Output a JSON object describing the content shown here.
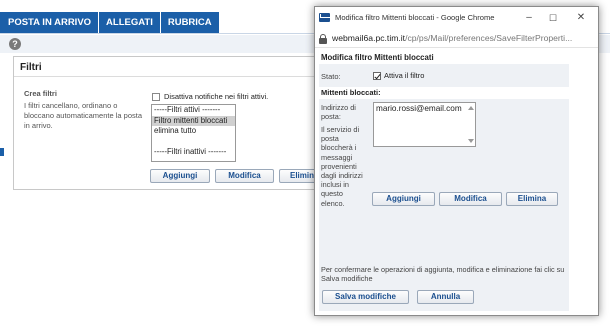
{
  "tabs": [
    "POSTA IN ARRIVO",
    "ALLEGATI",
    "RUBRICA"
  ],
  "help": {
    "icon": "help-icon",
    "glyph": "?"
  },
  "filtri": {
    "title": "Filtri",
    "crea_label": "Crea filtri",
    "crea_desc": "I filtri cancellano, ordinano o bloccano automaticamente la posta in arrivo.",
    "disattiva_label": "Disattiva notifiche nei filtri attivi.",
    "list": {
      "item0": "-----Filtri attivi -------",
      "item1": "Filtro mittenti bloccati",
      "item2": "elimina tutto",
      "item3": "-----Filtri inattivi -------"
    },
    "buttons": {
      "aggiungi": "Aggiungi",
      "modifica": "Modifica",
      "elimina": "Elimina"
    }
  },
  "popup": {
    "window_title": "Modifica filtro Mittenti bloccati - Google Chrome",
    "controls": {
      "minimize": "–",
      "maximize": "☐",
      "close": "✕"
    },
    "url_host": "webmail6a.pc.tim.it",
    "url_path": "/cp/ps/Mail/preferences/SaveFilterProperti...",
    "heading": "Modifica filtro Mittenti bloccati",
    "stato_label": "Stato:",
    "attiva_label": "Attiva il filtro",
    "mittenti_header": "Mittenti bloccati:",
    "indirizzo_label": "Indirizzo di posta:",
    "servizio_text": "Il servizio di posta bloccherà i messaggi provenienti dagli indirizzi inclusi in questo elenco.",
    "address": "mario.rossi@email.com",
    "buttons": {
      "aggiungi": "Aggiungi",
      "modifica": "Modifica",
      "elimina": "Elimina"
    },
    "confirm_text": "Per confermare le operazioni di aggiunta, modifica e eliminazione fai clic su Salva modifiche",
    "save_label": "Salva modifiche",
    "cancel_label": "Annulla"
  },
  "colors": {
    "brand": "#1b5fa8",
    "button_text": "#1b4f8f",
    "panel_bg": "#eef1f5"
  }
}
